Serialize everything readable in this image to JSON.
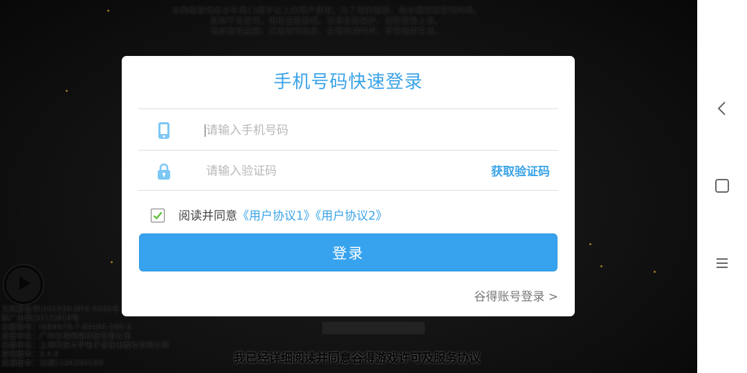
{
  "background": {
    "health_notice": [
      "本网络游戏适合年满13周岁以上的用户使用；为了您的健康，请合理控制游戏时间。",
      "抵制不良游戏，拒绝盗版游戏。注意自我保护，谨防受骗上当。",
      "适度游戏益脑，沉迷游戏伤身。合理安排时间，享受健康生活。"
    ],
    "publish_info": [
      "文网游备字[2015]M-RPG 0566号",
      "新广出审[2015]819号",
      "出版物号：ISBN978-7-89404-280-6",
      "运营单位：广州谷得网络科技有限公司",
      "出版单位：上海科技大学电子音像出版社有限公司",
      "游戏版本：3.4.0",
      "资源版本：日期1104260100"
    ],
    "bottom_notice": "我已经详细阅读并同意谷得游戏许可及服务协议"
  },
  "dialog": {
    "title": "手机号码快速登录",
    "phone_placeholder": "请输入手机号码",
    "code_placeholder": "请输入验证码",
    "get_code_label": "获取验证码",
    "agree_prefix": "阅读并同意",
    "agreement_1": "《用户协议1》",
    "agreement_2": "《用户协议2》",
    "agree_checked": true,
    "login_label": "登录",
    "alt_login_label": "谷得账号登录 >"
  },
  "nav": {
    "back_icon": "back-icon",
    "home_icon": "square-home-icon",
    "menu_icon": "menu-icon"
  },
  "colors": {
    "accent": "#3aa3e8",
    "button": "#37a3ee",
    "icon": "#7cc7f4",
    "check": "#5cbf3a"
  }
}
